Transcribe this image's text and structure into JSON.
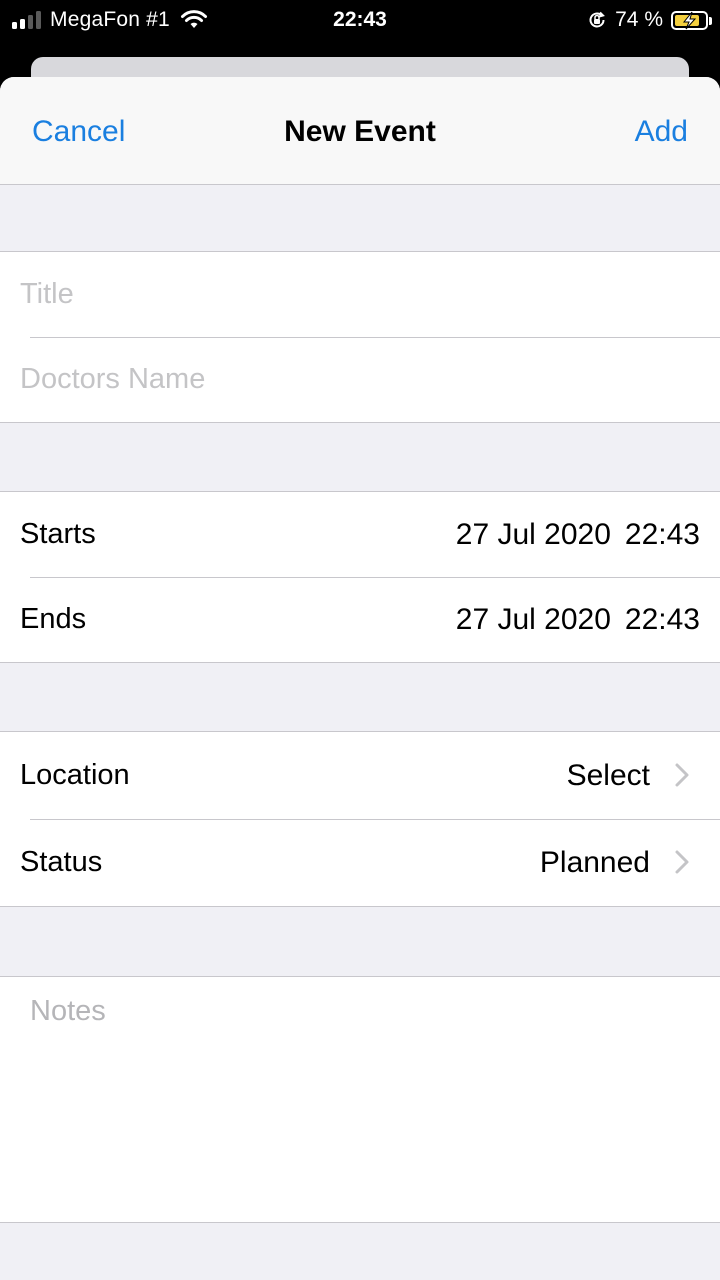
{
  "status_bar": {
    "carrier": "MegaFon #1",
    "time": "22:43",
    "battery_percent": "74 %",
    "signal_bars_active": 2,
    "signal_bars_total": 4,
    "icons": [
      "signal-icon",
      "wifi-icon",
      "orientation-lock-icon",
      "battery-charging-icon"
    ]
  },
  "nav": {
    "cancel_label": "Cancel",
    "title": "New Event",
    "add_label": "Add"
  },
  "form": {
    "title_placeholder": "Title",
    "doctor_placeholder": "Doctors Name",
    "starts_label": "Starts",
    "starts_date": "27 Jul 2020",
    "starts_time": "22:43",
    "ends_label": "Ends",
    "ends_date": "27 Jul 2020",
    "ends_time": "22:43",
    "location_label": "Location",
    "location_value": "Select",
    "status_label": "Status",
    "status_value": "Planned",
    "notes_placeholder": "Notes"
  },
  "colors": {
    "accent": "#1a7fe0",
    "background": "#f0f0f5",
    "separator": "#c8c7cc",
    "placeholder": "#c4c4c6",
    "battery": "#f4d03f"
  }
}
